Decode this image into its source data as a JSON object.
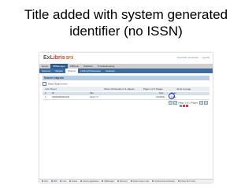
{
  "slide": {
    "title_line1": "Title added with system generated",
    "title_line2": "identifier (no ISSN)"
  },
  "app": {
    "logo_ex": "Ex",
    "logo_libris": "Libris",
    "logo_sfx": "SFX",
    "user_links": [
      "OpenURL Generator",
      "Log Off"
    ],
    "main_nav": [
      "Home",
      "KBManager",
      "KBTools",
      "Statistics",
      "Troubleshooting"
    ],
    "main_nav_active": 1,
    "sub_nav": [
      "Sources",
      "Targets",
      "Objects",
      "Linking Parameters",
      "Institutes"
    ],
    "sub_nav_active": 2,
    "section_title": "Search objects",
    "filter_label": "Show Search form",
    "toolbar": {
      "add": "Add Object",
      "show": "Show",
      "show_value": "10",
      "results": "Results of 1 objects",
      "page": "Page 1 of 1 Pages",
      "jump": "Jump to page"
    },
    "columns": [
      "#",
      "ID",
      "Title",
      "Type",
      "Status"
    ],
    "rows": [
      {
        "num": "1",
        "id": "3000000000001234",
        "title": "Daiichi Yo",
        "type": "JOURNAL",
        "status": "Active"
      }
    ],
    "footer_pager": "Page 1 of 1 Pages",
    "highlight_color": "#1c2bc4",
    "taskbar": [
      "Intro",
      "PDF",
      "Lists",
      "Delete",
      "Library application",
      "KBManager",
      "Directory",
      "Follow these Links",
      "Institute Area Activation",
      "Follow SFX Instrs"
    ]
  }
}
